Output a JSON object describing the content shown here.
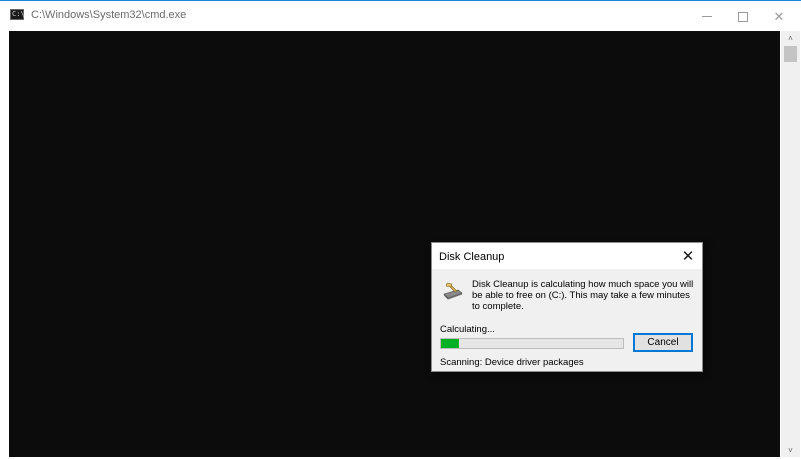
{
  "window": {
    "title": "C:\\Windows\\System32\\cmd.exe",
    "app_icon_glyph": "C:\\",
    "icons": {
      "app": "command-prompt-icon",
      "minimize": "minimize-icon",
      "maximize": "maximize-icon",
      "close": "close-icon"
    },
    "close_glyph": "✕",
    "colors": {
      "console_bg": "#0c0c0c",
      "accent": "#1883d7"
    }
  },
  "scrollbar": {
    "up_glyph": "˄",
    "down_glyph": "˅"
  },
  "dialog": {
    "title": "Disk Cleanup",
    "close_glyph": "✕",
    "icon": "disk-cleanup-icon",
    "message": "Disk Cleanup is calculating how much space you will be able to free on  (C:). This may take a few minutes to complete.",
    "calculating_label": "Calculating...",
    "progress_percent": 10,
    "progress_color": "#06b025",
    "cancel_label": "Cancel",
    "scanning_label": "Scanning:  Device driver packages"
  }
}
